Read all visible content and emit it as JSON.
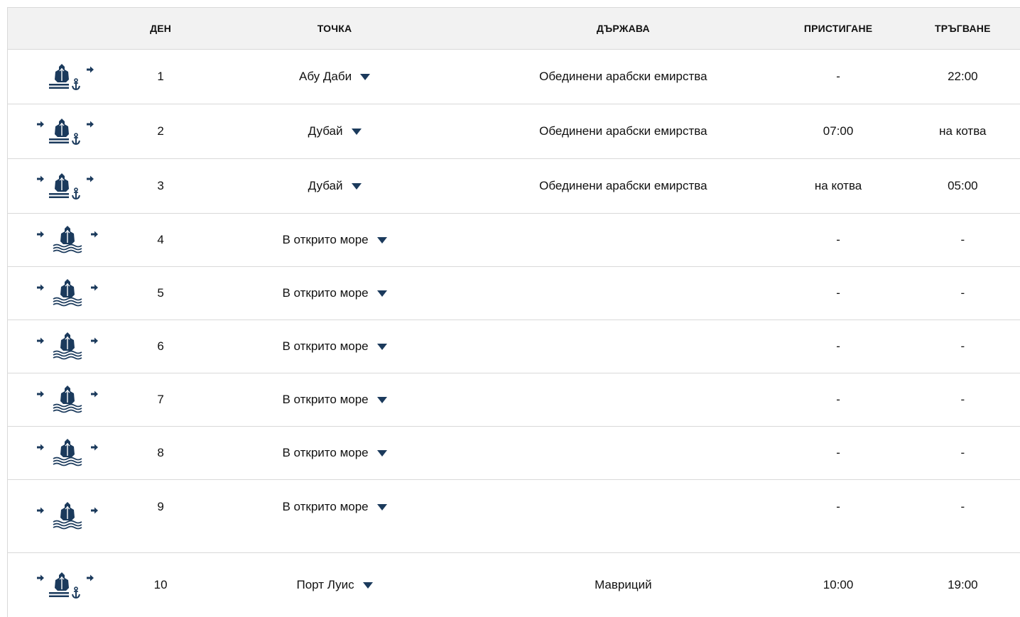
{
  "header": {
    "day": "ДЕН",
    "point": "ТОЧКА",
    "country": "ДЪРЖАВА",
    "arrival": "ПРИСТИГАНЕ",
    "departure": "ТРЪГВАНЕ"
  },
  "colors": {
    "icon": "#1b3a5c",
    "border": "#d9d9d9",
    "header_bg": "#f2f2f2"
  },
  "rows": [
    {
      "icon": "port-start-icon",
      "day": "1",
      "point": "Абу Даби",
      "country": "Обединени арабски емирства",
      "arrival": "-",
      "departure": "22:00"
    },
    {
      "icon": "port-icon",
      "day": "2",
      "point": "Дубай",
      "country": "Обединени арабски емирства",
      "arrival": "07:00",
      "departure": "на котва"
    },
    {
      "icon": "port-icon",
      "day": "3",
      "point": "Дубай",
      "country": "Обединени арабски емирства",
      "arrival": "на котва",
      "departure": "05:00"
    },
    {
      "icon": "sea-icon",
      "day": "4",
      "point": "В открито море",
      "country": "",
      "arrival": "-",
      "departure": "-"
    },
    {
      "icon": "sea-icon",
      "day": "5",
      "point": "В открито море",
      "country": "",
      "arrival": "-",
      "departure": "-"
    },
    {
      "icon": "sea-icon",
      "day": "6",
      "point": "В открито море",
      "country": "",
      "arrival": "-",
      "departure": "-"
    },
    {
      "icon": "sea-icon",
      "day": "7",
      "point": "В открито море",
      "country": "",
      "arrival": "-",
      "departure": "-"
    },
    {
      "icon": "sea-icon",
      "day": "8",
      "point": "В открито море",
      "country": "",
      "arrival": "-",
      "departure": "-"
    },
    {
      "icon": "sea-icon",
      "day": "9",
      "point": "В открито море",
      "country": "",
      "arrival": "-",
      "departure": "-"
    },
    {
      "icon": "port-icon",
      "day": "10",
      "point": "Порт Луис",
      "country": "Мавриций",
      "arrival": "10:00",
      "departure": "19:00"
    }
  ]
}
